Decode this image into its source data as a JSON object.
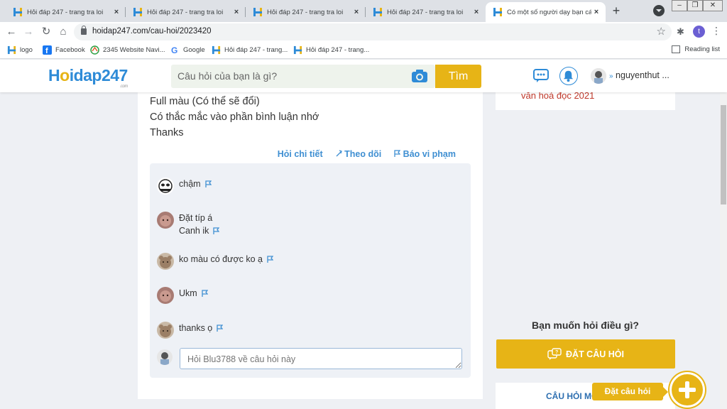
{
  "browser": {
    "tabs": [
      {
        "title": "Hỏi đáp 247 - trang tra loi",
        "active": false
      },
      {
        "title": "Hỏi đáp 247 - trang tra loi",
        "active": false
      },
      {
        "title": "Hỏi đáp 247 - trang tra loi",
        "active": false
      },
      {
        "title": "Hỏi đáp 247 - trang tra loi",
        "active": false
      },
      {
        "title": "Có một số người dạy bạn cách",
        "active": true
      }
    ],
    "tab_close": "×",
    "new_tab": "+",
    "url": "hoidap247.com/cau-hoi/2023420",
    "profile_initial": "t",
    "bookmarks": [
      {
        "label": "logo"
      },
      {
        "label": "Facebook"
      },
      {
        "label": "2345 Website Navi..."
      },
      {
        "label": "Google"
      },
      {
        "label": "Hỏi đáp 247 - trang..."
      },
      {
        "label": "Hỏi đáp 247 - trang..."
      }
    ],
    "reading_list": "Reading list"
  },
  "site": {
    "logo_prefix": "H",
    "logo_y": "o",
    "logo_rest": "idap247",
    "logo_com": ".com",
    "search_placeholder": "Câu hỏi của bạn là gì?",
    "search_button": "Tìm",
    "username": "nguyenthut ...",
    "username_chevron": "»"
  },
  "question": {
    "lines": [
      "Full màu (Có thể sẽ đổi)",
      "Có thắc mắc vào phần bình luận nhớ",
      "Thanks"
    ],
    "actions": {
      "detail": "Hỏi chi tiết",
      "follow": "Theo dõi",
      "report": "Báo vi phạm"
    }
  },
  "comments": [
    {
      "lines": [
        "chậm"
      ]
    },
    {
      "lines": [
        "Đặt típ á",
        "Canh ik"
      ]
    },
    {
      "lines": [
        "ko màu có được ko ạ"
      ]
    },
    {
      "lines": [
        "Ukm"
      ]
    },
    {
      "lines": [
        "thanks ọ"
      ]
    }
  ],
  "reply_placeholder": "Hỏi Blu3788 về câu hỏi này",
  "sidebar": {
    "top_card_text": "văn hoá đọc 2021",
    "ask_title": "Bạn muốn hỏi điều gì?",
    "ask_button": "ĐẶT CÂU HỎI",
    "new_questions": "CÂU HỎI MỚI",
    "tooltip": "Đặt câu hỏi"
  },
  "colors": {
    "brand_blue": "#2e8bd7",
    "brand_yellow": "#e7b416",
    "link_blue": "#3f8fd2",
    "alert_red": "#c0392b"
  }
}
